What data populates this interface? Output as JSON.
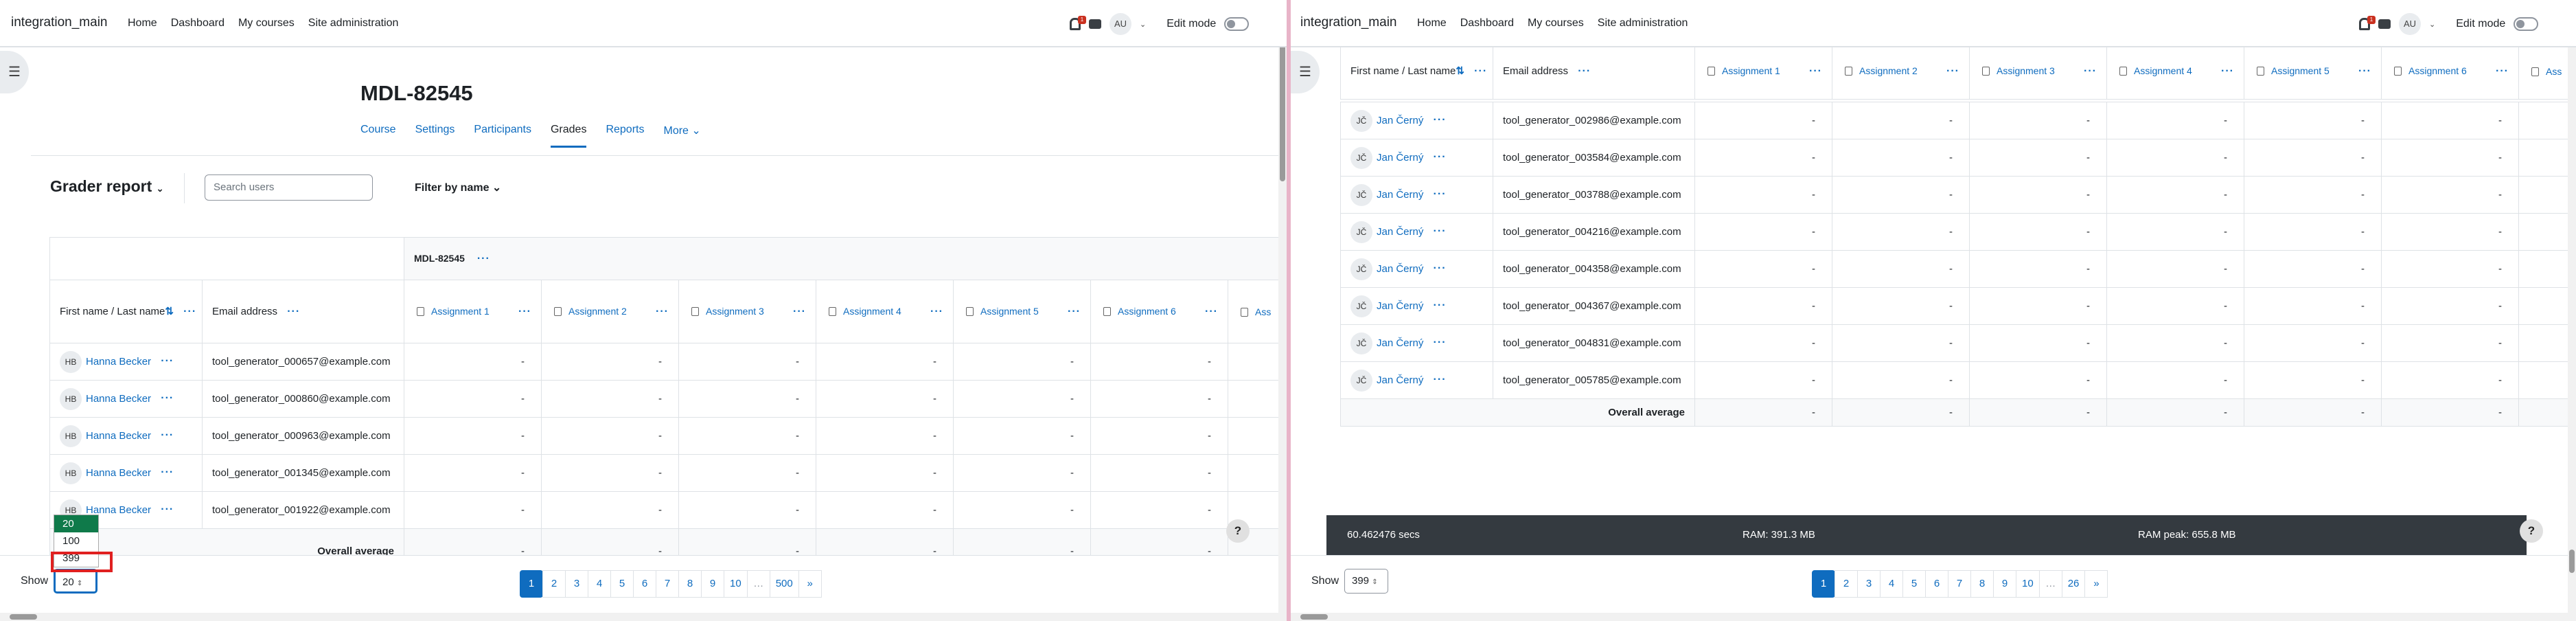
{
  "left": {
    "site_name": "integration_main",
    "nav": [
      "Home",
      "Dashboard",
      "My courses",
      "Site administration"
    ],
    "user_initials": "AU",
    "edit_mode": "Edit mode",
    "notif_count": "1",
    "course_title": "MDL-82545",
    "tabs": [
      "Course",
      "Settings",
      "Participants",
      "Grades",
      "Reports",
      "More"
    ],
    "report_title": "Grader report",
    "search_placeholder": "Search users",
    "filter_label": "Filter by name",
    "category": "MDL-82545",
    "col_name": "First name / Last name",
    "col_email": "Email address",
    "assignments": [
      "Assignment 1",
      "Assignment 2",
      "Assignment 3",
      "Assignment 4",
      "Assignment 5",
      "Assignment 6",
      "Ass"
    ],
    "rows": [
      {
        "initials": "HB",
        "name": "Hanna Becker",
        "email": "tool_generator_000657@example.com"
      },
      {
        "initials": "HB",
        "name": "Hanna Becker",
        "email": "tool_generator_000860@example.com"
      },
      {
        "initials": "HB",
        "name": "Hanna Becker",
        "email": "tool_generator_000963@example.com"
      },
      {
        "initials": "HB",
        "name": "Hanna Becker",
        "email": "tool_generator_001345@example.com"
      },
      {
        "initials": "HB",
        "name": "Hanna Becker",
        "email": "tool_generator_001922@example.com"
      }
    ],
    "grade": "-",
    "overall": "Overall average",
    "show_label": "Show",
    "show_value": "20",
    "options": [
      "20",
      "100",
      "399"
    ],
    "pages": [
      "1",
      "2",
      "3",
      "4",
      "5",
      "6",
      "7",
      "8",
      "9",
      "10",
      "…",
      "500",
      "»"
    ]
  },
  "right": {
    "site_name": "integration_main",
    "nav": [
      "Home",
      "Dashboard",
      "My courses",
      "Site administration"
    ],
    "user_initials": "AU",
    "edit_mode": "Edit mode",
    "notif_count": "1",
    "col_name": "First name / Last name",
    "col_email": "Email address",
    "assignments": [
      "Assignment 1",
      "Assignment 2",
      "Assignment 3",
      "Assignment 4",
      "Assignment 5",
      "Assignment 6",
      "Ass"
    ],
    "rows": [
      {
        "initials": "JČ",
        "name": "Jan Černý",
        "email": "tool_generator_002986@example.com"
      },
      {
        "initials": "JČ",
        "name": "Jan Černý",
        "email": "tool_generator_003584@example.com"
      },
      {
        "initials": "JČ",
        "name": "Jan Černý",
        "email": "tool_generator_003788@example.com"
      },
      {
        "initials": "JČ",
        "name": "Jan Černý",
        "email": "tool_generator_004216@example.com"
      },
      {
        "initials": "JČ",
        "name": "Jan Černý",
        "email": "tool_generator_004358@example.com"
      },
      {
        "initials": "JČ",
        "name": "Jan Černý",
        "email": "tool_generator_004367@example.com"
      },
      {
        "initials": "JČ",
        "name": "Jan Černý",
        "email": "tool_generator_004831@example.com"
      },
      {
        "initials": "JČ",
        "name": "Jan Černý",
        "email": "tool_generator_005785@example.com"
      }
    ],
    "grade": "-",
    "overall": "Overall average",
    "perf": {
      "secs": "60.462476 secs",
      "ram": "RAM: 391.3 MB",
      "peak": "RAM peak: 655.8 MB"
    },
    "show_label": "Show",
    "show_value": "399",
    "pages": [
      "1",
      "2",
      "3",
      "4",
      "5",
      "6",
      "7",
      "8",
      "9",
      "10",
      "…",
      "26",
      "»"
    ]
  }
}
